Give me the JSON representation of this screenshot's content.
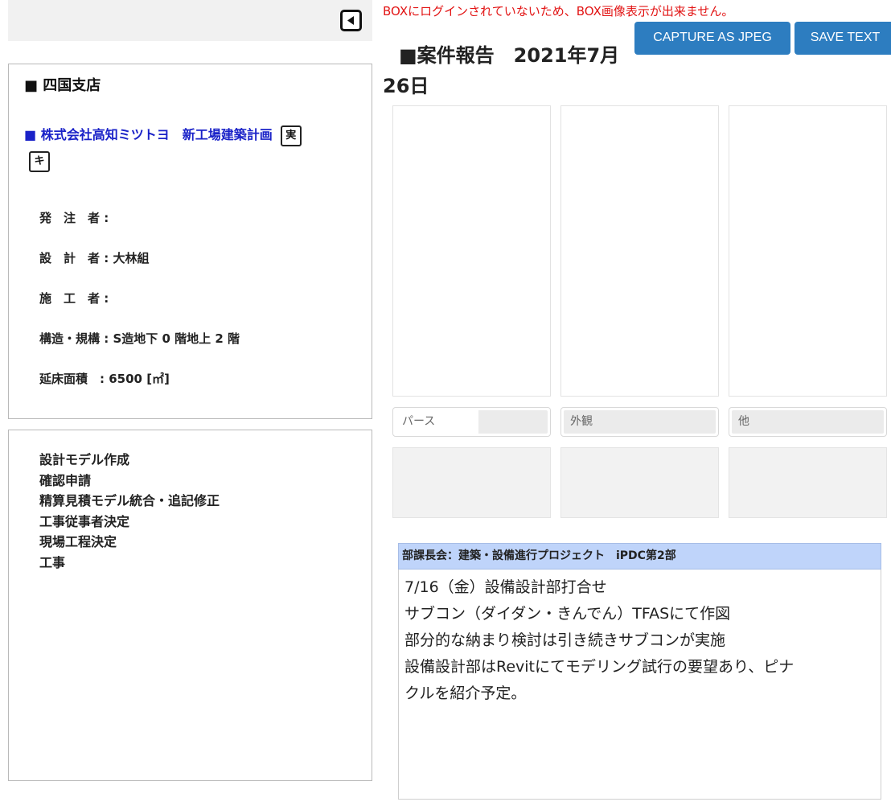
{
  "header": {
    "box_warning": "BOXにログインされていないため、BOX画像表示が出来ません。",
    "capture_label": "CAPTURE AS JPEG",
    "save_label": "SAVE TEXT"
  },
  "report": {
    "title": "■案件報告　2021年7月26日"
  },
  "project": {
    "branch": "■ 四国支店",
    "name": "■ 株式会社高知ミツトヨ　新工場建築計画",
    "tag_1": "実",
    "tag_2": "キ",
    "fields": {
      "client": "発　注　者 :",
      "designer": "設　計　者 : 大林組",
      "contractor": "施　工　者 :",
      "structure": "構造・規構 : S造地下 0 階地上 2 階",
      "floor_area": "延床面積　: 6500 [㎡]"
    }
  },
  "tasks": [
    "設計モデル作成",
    "確認申請",
    "精算見積モデル統合・追記修正",
    "工事従事者決定",
    "現場工程決定",
    "工事"
  ],
  "images": {
    "captions": [
      "パース",
      "外観",
      "他"
    ]
  },
  "memo": {
    "header": "部課長会：建築・設備進行プロジェクト　iPDC第2部",
    "lines": [
      "7/16（金）設備設計部打合せ",
      "サブコン（ダイダン・きんでん）TFASにて作図",
      "部分的な納まり検討は引き続きサブコンが実施",
      "設備設計部はRevitにてモデリング試行の要望あり、ピナ",
      "クルを紹介予定。"
    ]
  },
  "colors": {
    "button_blue": "#2d7dc0",
    "project_link": "#1a22c8",
    "warning_red": "#e21414",
    "memo_header_bg": "#bfd4fa"
  },
  "icons": {
    "back": "collapse-left-icon"
  }
}
